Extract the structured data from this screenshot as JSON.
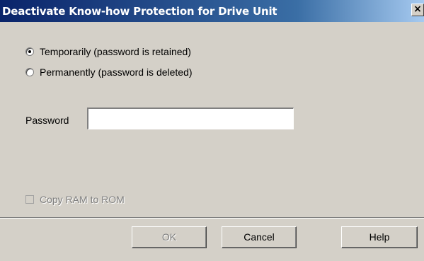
{
  "window": {
    "title": "Deactivate Know-how Protection for Drive Unit",
    "close_glyph": "×"
  },
  "options": [
    {
      "label": "Temporarily (password is retained)",
      "selected": true
    },
    {
      "label": "Permanently (password is deleted)",
      "selected": false
    }
  ],
  "password": {
    "label": "Password",
    "value": ""
  },
  "copy_ram": {
    "label": "Copy RAM to ROM",
    "checked": false,
    "enabled": false
  },
  "buttons": {
    "ok": "OK",
    "cancel": "Cancel",
    "help": "Help"
  }
}
